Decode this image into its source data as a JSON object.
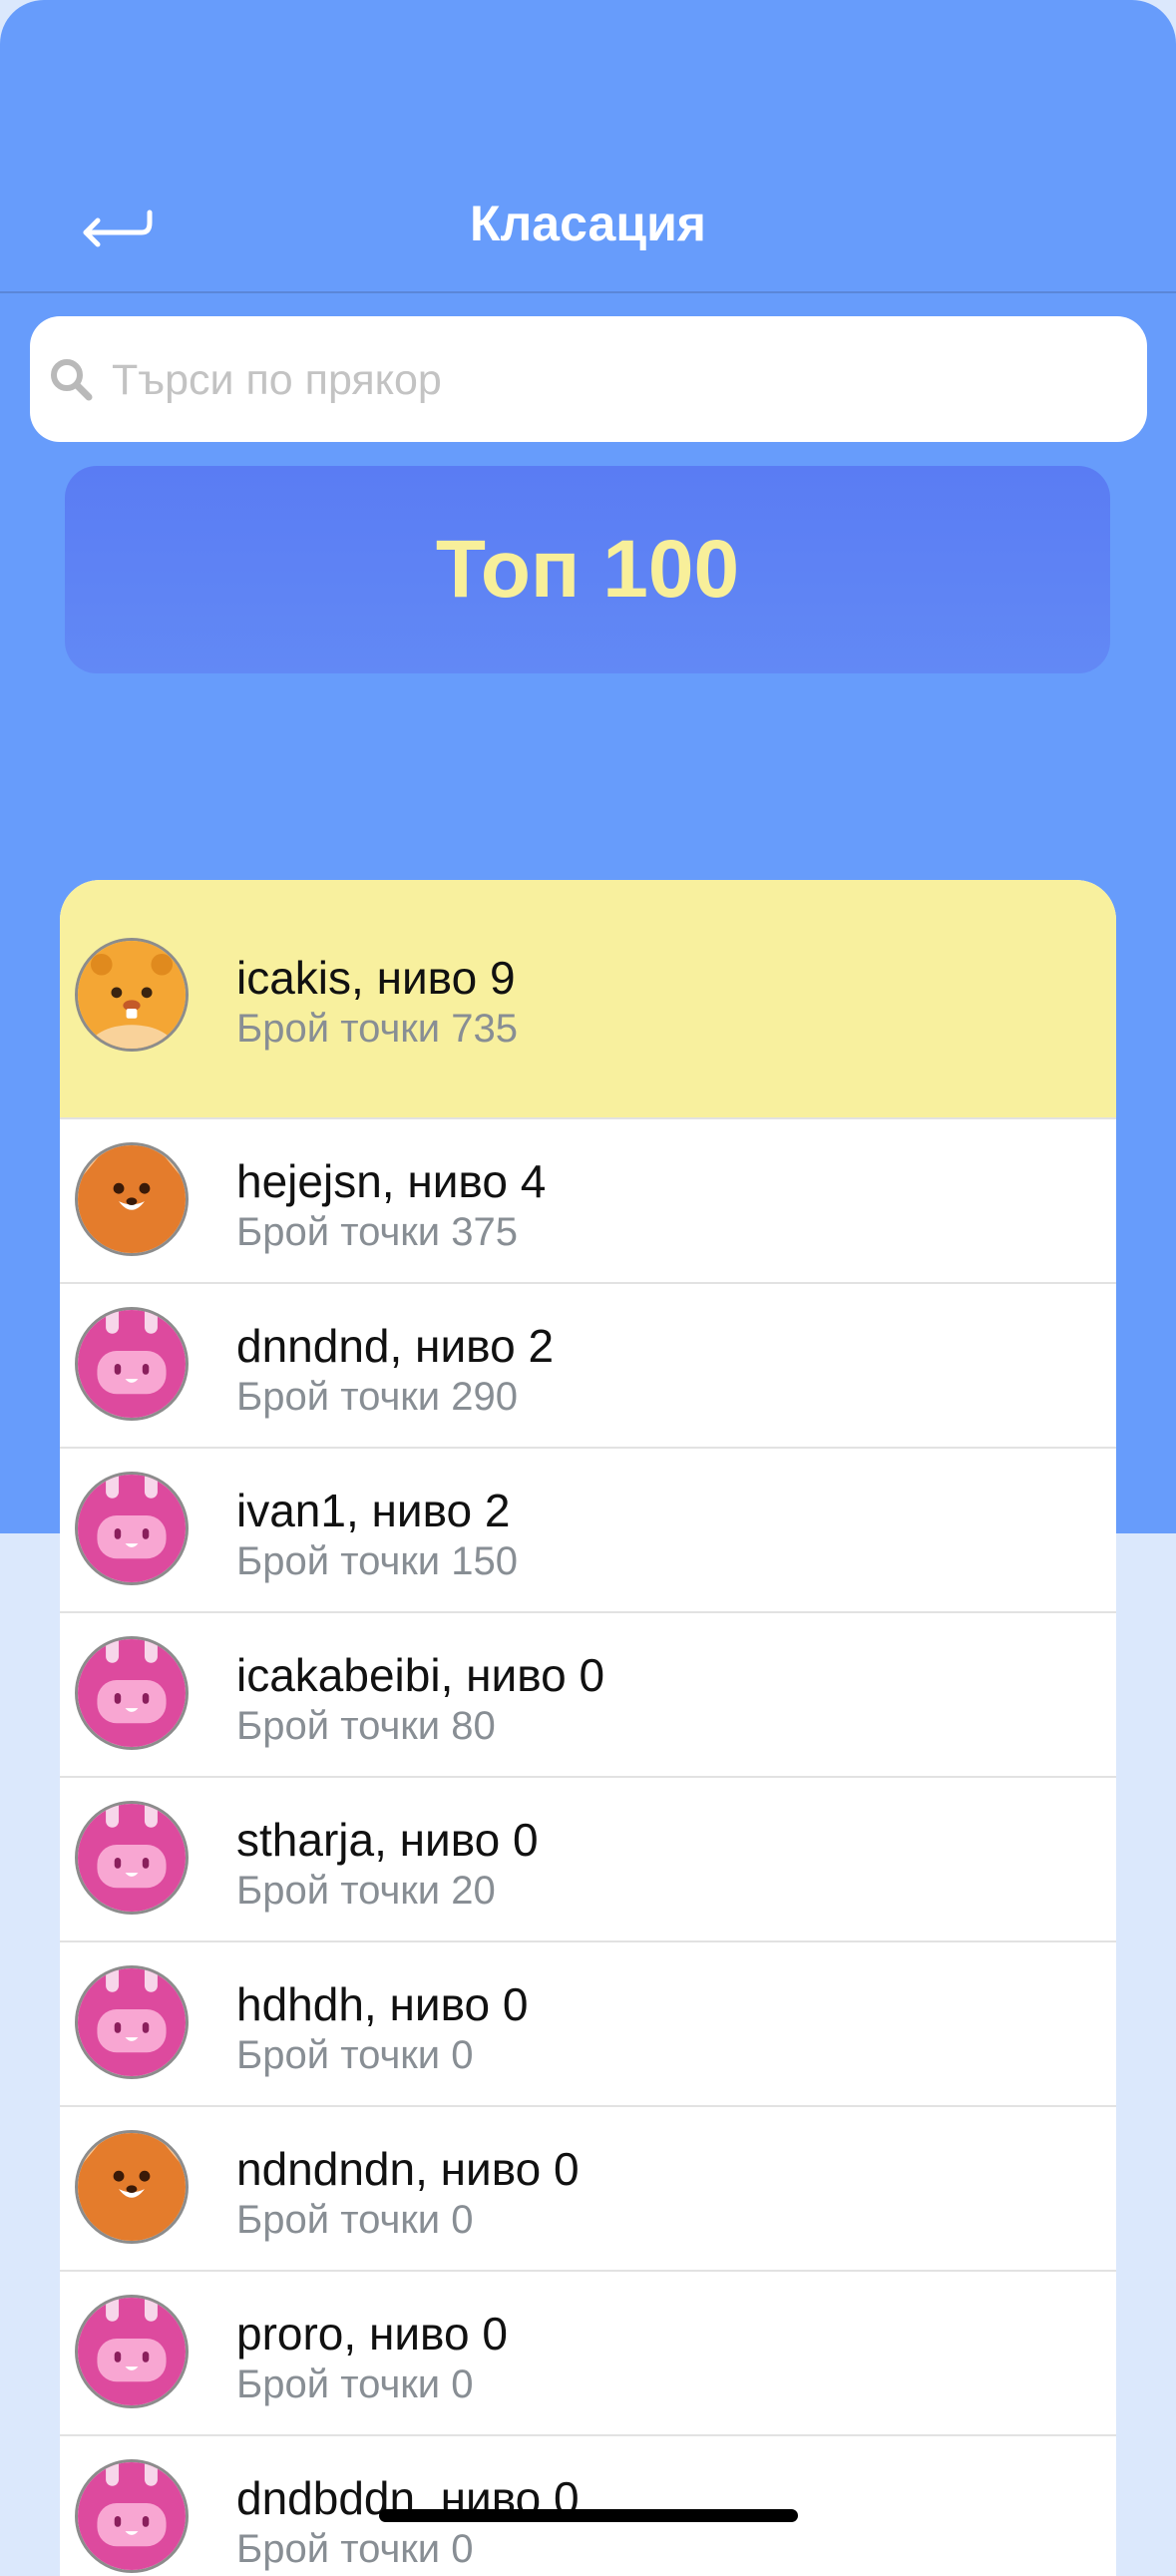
{
  "nav": {
    "title": "Класация",
    "back_icon": "back-arrow-icon"
  },
  "search": {
    "placeholder": "Търси по прякор",
    "value": "",
    "icon": "search-icon"
  },
  "banner": {
    "label": "Топ 100"
  },
  "leaderboard": [
    {
      "name": "icakis, ниво 9",
      "points": "Брой точки 735",
      "avatar": "hamster"
    },
    {
      "name": "hejejsn, ниво 4",
      "points": "Брой точки 375",
      "avatar": "fox"
    },
    {
      "name": "dnndnd, ниво 2",
      "points": "Брой точки 290",
      "avatar": "pink-bunny"
    },
    {
      "name": "ivan1, ниво 2",
      "points": "Брой точки 150",
      "avatar": "pink-bunny"
    },
    {
      "name": "icakabeibi, ниво 0",
      "points": "Брой точки 80",
      "avatar": "pink-bunny"
    },
    {
      "name": "stharja, ниво 0",
      "points": "Брой точки 20",
      "avatar": "pink-bunny"
    },
    {
      "name": "hdhdh, ниво 0",
      "points": "Брой точки 0",
      "avatar": "pink-bunny"
    },
    {
      "name": "ndndndn, ниво 0",
      "points": "Брой точки 0",
      "avatar": "fox"
    },
    {
      "name": "proro, ниво 0",
      "points": "Брой точки 0",
      "avatar": "pink-bunny"
    },
    {
      "name": "dndbddn, ниво 0",
      "points": "Брой точки 0",
      "avatar": "pink-bunny"
    }
  ],
  "colors": {
    "header_bg": "#679cfb",
    "page_bg": "#dbe8fc",
    "banner_bg": "#5a7cf3",
    "banner_text": "#f8ef9a",
    "highlight_row": "#f8f09e",
    "hamster": "#f4a634",
    "fox": "#e47c2c",
    "pink_bunny": "#dd4a9e"
  }
}
